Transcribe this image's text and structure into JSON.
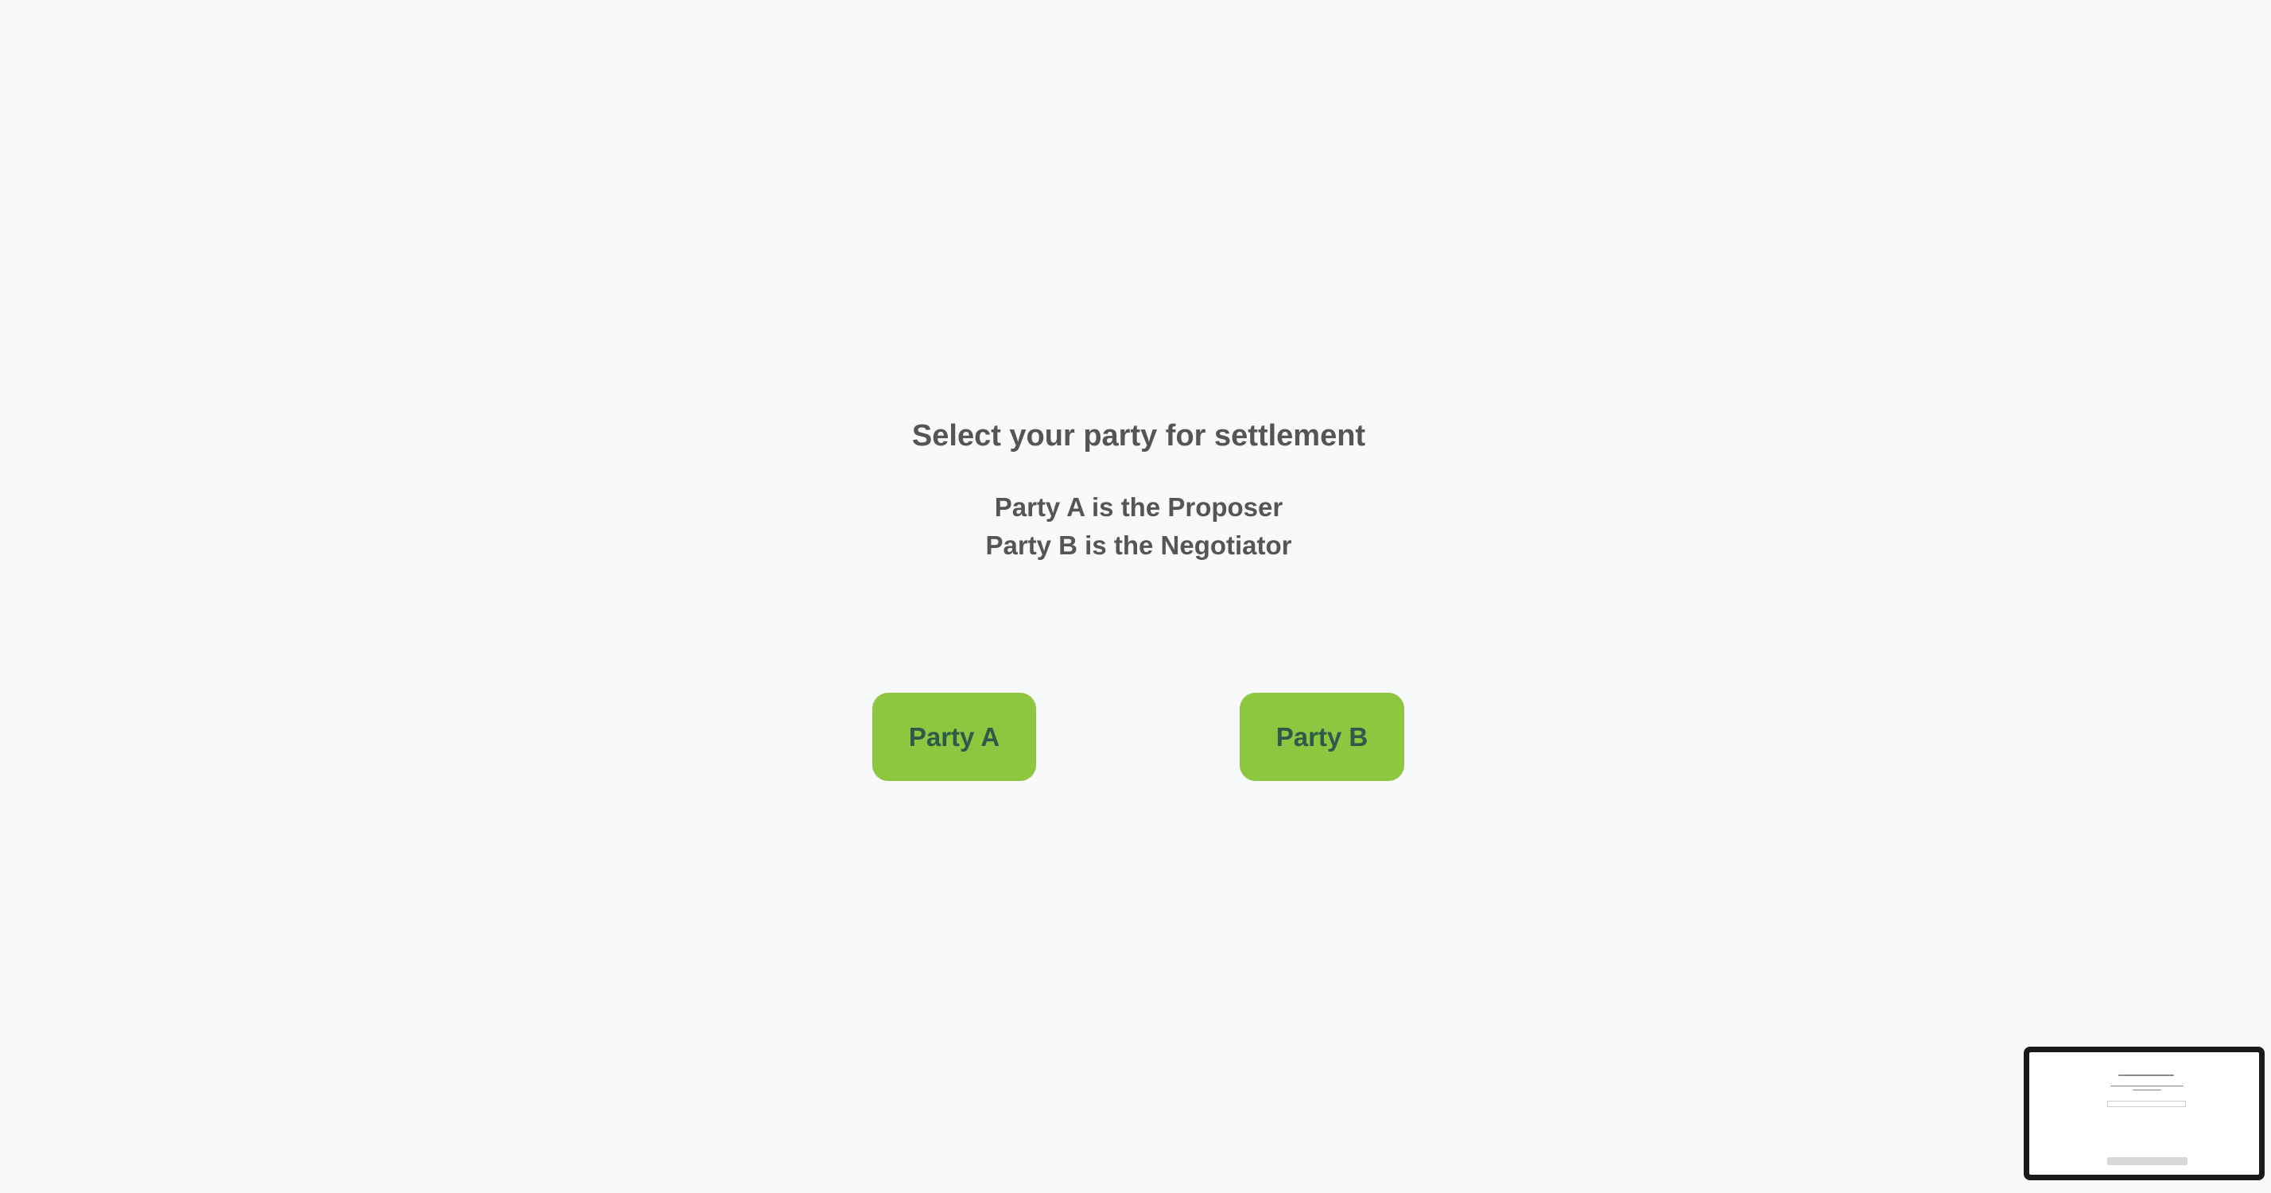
{
  "page": {
    "title": "Select your party for settlement",
    "subtitle_lines": [
      "Party A is the Proposer",
      "Party B is the Negotiator"
    ]
  },
  "buttons": {
    "party_a": "Party A",
    "party_b": "Party B"
  },
  "colors": {
    "background": "#f8f9fa",
    "button": "#8dc63f",
    "button_text": "#2d5a4a",
    "text": "#555555"
  }
}
